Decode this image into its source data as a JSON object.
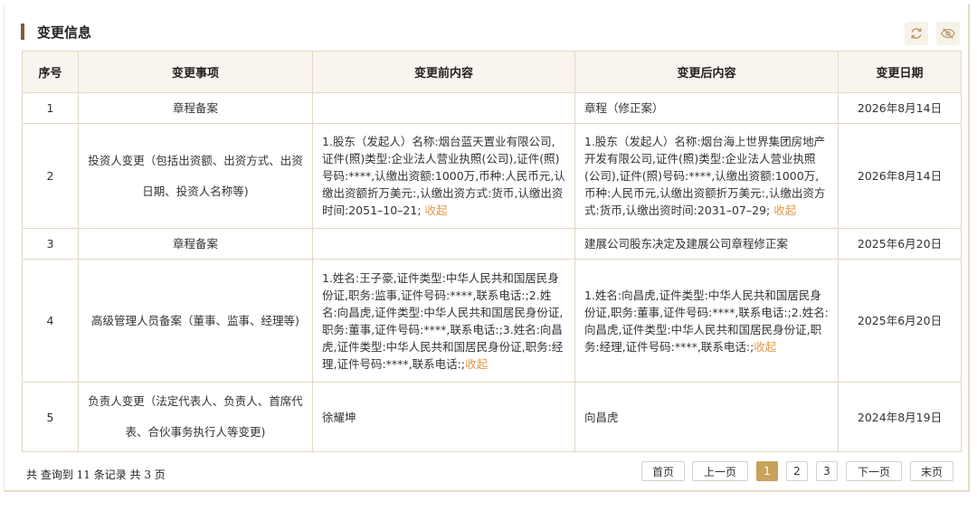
{
  "header": {
    "title": "变更信息"
  },
  "icons": {
    "refresh": "refresh-icon",
    "visibility": "eye-slash-icon",
    "accent": "#8a5a35",
    "active_page": "#c8a25a",
    "link": "#e39a4c"
  },
  "table": {
    "columns": [
      "序号",
      "变更事项",
      "变更前内容",
      "变更后内容",
      "变更日期"
    ],
    "rows": [
      {
        "no": "1",
        "item": [
          "章程备案"
        ],
        "before": "",
        "before_link": "",
        "after": "章程（修正案）",
        "after_link": "",
        "date": "2026年8月14日"
      },
      {
        "no": "2",
        "item": [
          "投资人变更（包括出资额、出资方式、出资",
          "日期、投资人名称等)"
        ],
        "before": "1.股东（发起人）名称:烟台蓝天置业有限公司,证件(照)类型:企业法人营业执照(公司),证件(照)号码:****,认缴出资额:1000万,币种:人民币元,认缴出资额折万美元:,认缴出资方式:货币,认缴出资时间:2051–10–21; ",
        "before_link": "收起",
        "after": "1.股东（发起人）名称:烟台海上世界集团房地产开发有限公司,证件(照)类型:企业法人营业执照(公司),证件(照)号码:****,认缴出资额:1000万,币种:人民币元,认缴出资额折万美元:,认缴出资方式:货币,认缴出资时间:2031–07–29; ",
        "after_link": "收起",
        "date": "2026年8月14日"
      },
      {
        "no": "3",
        "item": [
          "章程备案"
        ],
        "before": "",
        "before_link": "",
        "after": "建展公司股东决定及建展公司章程修正案",
        "after_link": "",
        "date": "2025年6月20日"
      },
      {
        "no": "4",
        "item": [
          "高级管理人员备案（董事、监事、经理等)"
        ],
        "before": "1.姓名:王子豪,证件类型:中华人民共和国居民身份证,职务:监事,证件号码:****,联系电话:;2.姓名:向昌虎,证件类型:中华人民共和国居民身份证,职务:董事,证件号码:****,联系电话:;3.姓名:向昌虎,证件类型:中华人民共和国居民身份证,职务:经理,证件号码:****,联系电话:;",
        "before_link": "收起",
        "after": "1.姓名:向昌虎,证件类型:中华人民共和国居民身份证,职务:董事,证件号码:****,联系电话:;2.姓名:向昌虎,证件类型:中华人民共和国居民身份证,职务:经理,证件号码:****,联系电话:;",
        "after_link": "收起",
        "date": "2025年6月20日"
      },
      {
        "no": "5",
        "item": [
          "负责人变更（法定代表人、负责人、首席代",
          "表、合伙事务执行人等变更)"
        ],
        "before": "徐耀坤",
        "before_link": "",
        "after": "向昌虎",
        "after_link": "",
        "date": "2024年8月19日"
      }
    ]
  },
  "footer": {
    "summary": "共 查询到 11 条记录 共 3 页"
  },
  "pager": {
    "first": "首页",
    "prev": "上一页",
    "pages": [
      "1",
      "2",
      "3"
    ],
    "current": "1",
    "next": "下一页",
    "last": "末页"
  }
}
